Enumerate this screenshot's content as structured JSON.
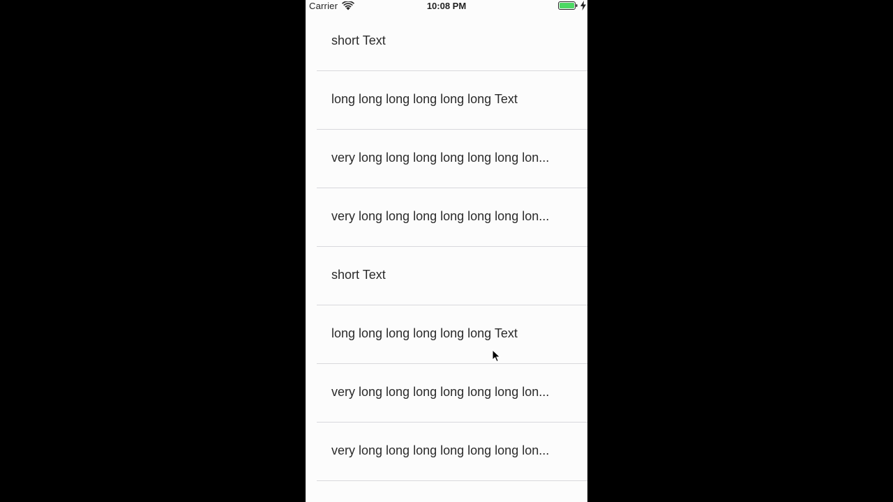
{
  "status_bar": {
    "carrier": "Carrier",
    "time": "10:08 PM",
    "icons": {
      "wifi": "wifi-icon",
      "battery": "battery-icon",
      "charging": "bolt-icon"
    },
    "battery_color": "#4cd964"
  },
  "rows": [
    {
      "label": "short Text"
    },
    {
      "label": "long long long long long long Text"
    },
    {
      "label": "very long long long long long long lon..."
    },
    {
      "label": "very long long long long long long lon..."
    },
    {
      "label": "short Text"
    },
    {
      "label": "long long long long long long Text"
    },
    {
      "label": "very long long long long long long lon..."
    },
    {
      "label": "very long long long long long long lon..."
    }
  ],
  "cursor": {
    "icon": "pointer-cursor-icon"
  }
}
